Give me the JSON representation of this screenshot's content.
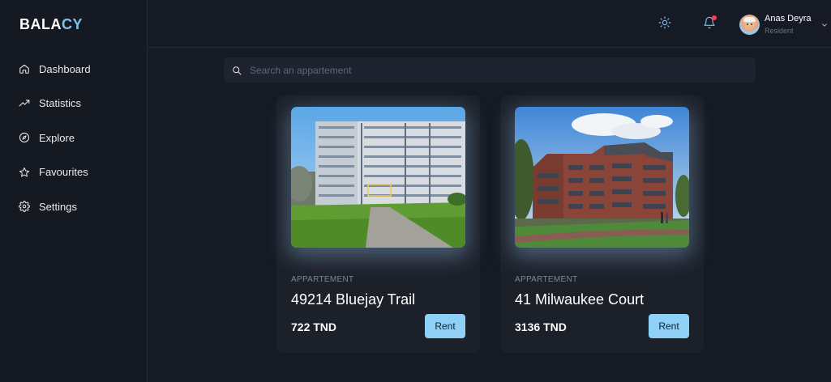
{
  "brand": {
    "prefix": "BALA",
    "accent": "CY",
    "accent_color": "#7cc3ee"
  },
  "sidebar": {
    "items": [
      {
        "label": "Dashboard",
        "icon": "home-icon"
      },
      {
        "label": "Statistics",
        "icon": "trending-up-icon"
      },
      {
        "label": "Explore",
        "icon": "compass-icon"
      },
      {
        "label": "Favourites",
        "icon": "star-icon"
      },
      {
        "label": "Settings",
        "icon": "gear-icon"
      }
    ]
  },
  "header": {
    "theme_icon": "sun-icon",
    "notification_icon": "bell-icon",
    "notification_dot_color": "#ff3b4d",
    "user": {
      "name": "Anas Deyra",
      "role": "Resident"
    }
  },
  "search": {
    "placeholder": "Search an appartement",
    "value": ""
  },
  "listings": [
    {
      "type": "APPARTEMENT",
      "title": "49214 Bluejay Trail",
      "price": "722 TND",
      "button": "Rent"
    },
    {
      "type": "APPARTEMENT",
      "title": "41 Milwaukee Court",
      "price": "3136 TND",
      "button": "Rent"
    }
  ],
  "colors": {
    "background": "#161a24",
    "card": "#1c2029",
    "button": "#8fd0f7"
  }
}
